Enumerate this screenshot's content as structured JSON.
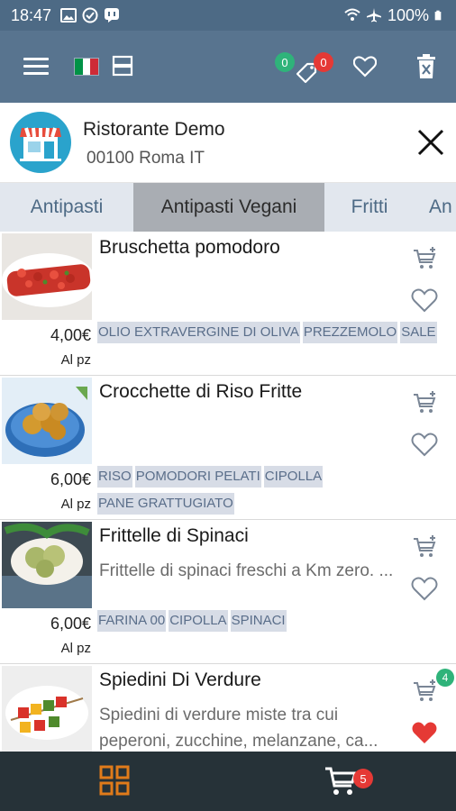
{
  "status_bar": {
    "time": "18:47",
    "battery": "100%",
    "icons": [
      "image-icon",
      "check-circle-icon",
      "chat-icon",
      "wifi-icon",
      "airplane-icon",
      "battery-icon"
    ]
  },
  "app_bar": {
    "color": "#58748f",
    "menu_icon": "menu-icon",
    "flag": "italian-flag",
    "tags_green_count": "0",
    "tags_red_count": "0"
  },
  "restaurant": {
    "name": "Ristorante Demo",
    "address": "00100 Roma IT"
  },
  "categories": [
    {
      "label": "Antipasti",
      "active": false
    },
    {
      "label": "Antipasti Vegani",
      "active": true
    },
    {
      "label": "Fritti",
      "active": false
    },
    {
      "label": "An",
      "active": false
    }
  ],
  "products": [
    {
      "name": "Bruschetta pomodoro",
      "description": "",
      "price": "4,00€",
      "unit": "Al pz",
      "tags": [
        "OLIO EXTRAVERGINE DI OLIVA",
        "PREZZEMOLO",
        "SALE"
      ],
      "favorite": false,
      "cart_count": ""
    },
    {
      "name": "Crocchette di Riso Fritte",
      "description": "",
      "price": "6,00€",
      "unit": "Al pz",
      "tags": [
        "RISO",
        "POMODORI PELATI",
        "CIPOLLA",
        "PANE GRATTUGIATO"
      ],
      "favorite": false,
      "cart_count": ""
    },
    {
      "name": "Frittelle di Spinaci",
      "description": "Frittelle di spinaci freschi a Km zero. ...",
      "price": "6,00€",
      "unit": "Al pz",
      "tags": [
        "FARINA 00",
        "CIPOLLA",
        "SPINACI"
      ],
      "favorite": false,
      "cart_count": ""
    },
    {
      "name": "Spiedini Di Verdure",
      "description": "Spiedini di verdure miste tra cui peperoni, zucchine, melanzane, ca...",
      "price": "",
      "unit": "",
      "tags": [],
      "favorite": true,
      "cart_count": "4"
    }
  ],
  "bottom_bar": {
    "cart_count": "5",
    "grid_color": "#e07b1a"
  }
}
